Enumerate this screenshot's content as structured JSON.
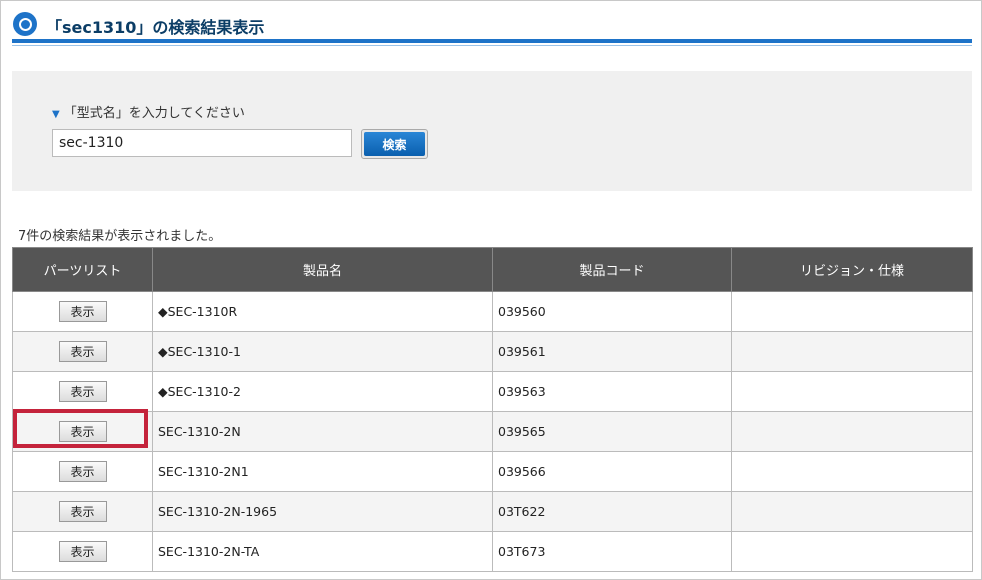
{
  "header": {
    "title": "「sec1310」の検索結果表示"
  },
  "search": {
    "label": "「型式名」を入力してください",
    "value": "sec-1310",
    "button": "検索"
  },
  "results": {
    "count_text": "7件の検索結果が表示されました。",
    "columns": [
      "パーツリスト",
      "製品名",
      "製品コード",
      "リビジョン・仕様"
    ],
    "rows": [
      {
        "button": "表示",
        "name": "◆SEC-1310R",
        "code": "039560",
        "revision": ""
      },
      {
        "button": "表示",
        "name": "◆SEC-1310-1",
        "code": "039561",
        "revision": ""
      },
      {
        "button": "表示",
        "name": "◆SEC-1310-2",
        "code": "039563",
        "revision": ""
      },
      {
        "button": "表示",
        "name": "SEC-1310-2N",
        "code": "039565",
        "revision": ""
      },
      {
        "button": "表示",
        "name": "SEC-1310-2N1",
        "code": "039566",
        "revision": ""
      },
      {
        "button": "表示",
        "name": "SEC-1310-2N-1965",
        "code": "03T622",
        "revision": ""
      },
      {
        "button": "表示",
        "name": "SEC-1310-2N-TA",
        "code": "03T673",
        "revision": ""
      }
    ]
  },
  "colors": {
    "accent": "#1e73c8",
    "header_bg": "#555555",
    "highlight": "#c4233b"
  }
}
